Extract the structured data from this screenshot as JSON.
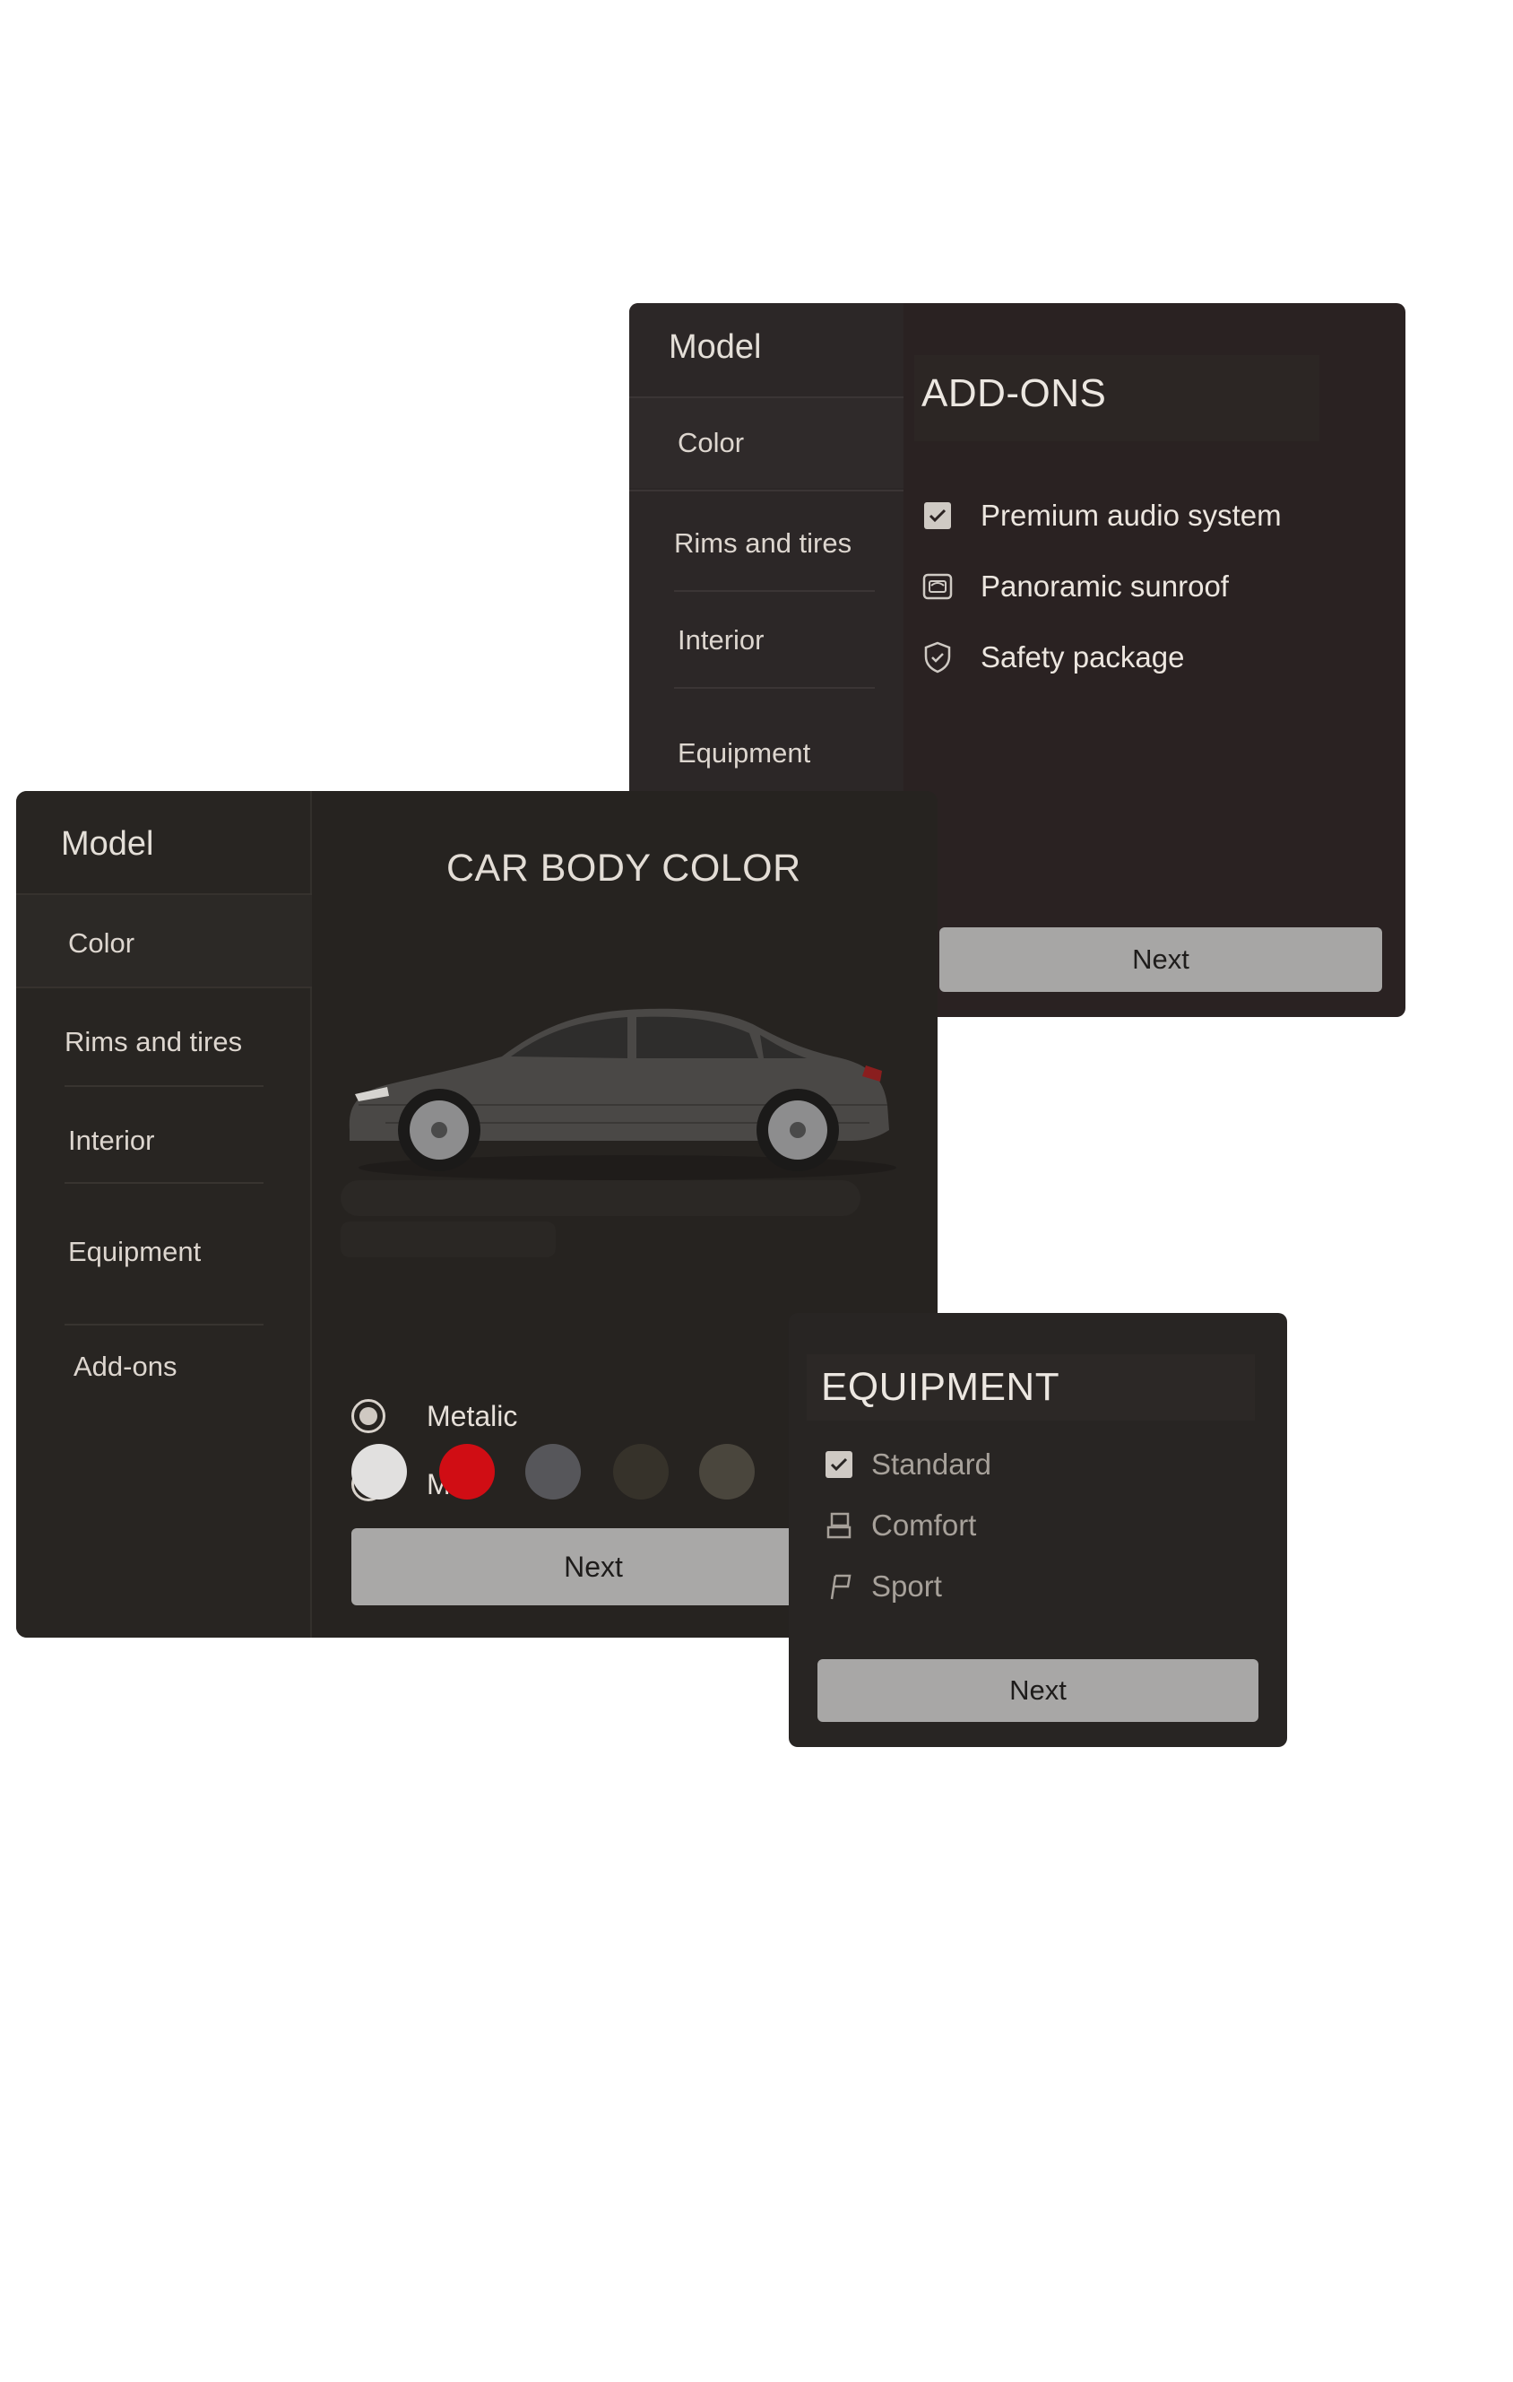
{
  "addons_panel": {
    "model": "Model",
    "nav": [
      "Color",
      "Rims and tires",
      "Interior",
      "Equipment"
    ],
    "title": "ADD-ONS",
    "options": [
      {
        "label": "Premium audio system",
        "icon": "checkbox-checked-icon"
      },
      {
        "label": "Panoramic sunroof",
        "icon": "sunroof-icon"
      },
      {
        "label": "Safety package",
        "icon": "shield-check-icon"
      }
    ],
    "next_label": "Next"
  },
  "color_panel": {
    "model": "Model",
    "nav": [
      "Color",
      "Rims and tires",
      "Interior",
      "Equipment",
      "Add-ons"
    ],
    "title": "CAR BODY COLOR",
    "finish_options": [
      {
        "label": "Metalic",
        "selected": true
      },
      {
        "label": "Mat",
        "selected": false
      }
    ],
    "swatches": [
      "#e1e0df",
      "#d00d14",
      "#56565a",
      "#36322a",
      "#4a463d"
    ],
    "next_label": "Next"
  },
  "equipment_panel": {
    "title": "EQUIPMENT",
    "options": [
      {
        "label": "Standard",
        "icon": "checkbox-checked-icon"
      },
      {
        "label": "Comfort",
        "icon": "seat-icon"
      },
      {
        "label": "Sport",
        "icon": "flag-icon"
      }
    ],
    "next_label": "Next"
  }
}
